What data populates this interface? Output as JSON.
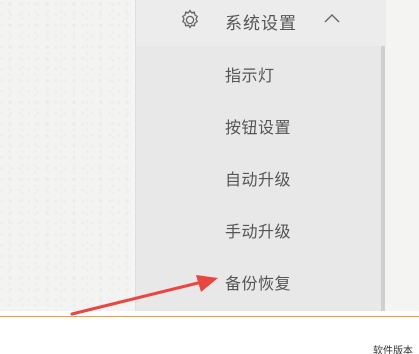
{
  "menu": {
    "header": {
      "label": "系统设置",
      "icon": "gear-icon",
      "chevron_icon": "chevron-up-icon"
    },
    "items": [
      {
        "label": "指示灯"
      },
      {
        "label": "按钮设置"
      },
      {
        "label": "自动升级"
      },
      {
        "label": "手动升级"
      },
      {
        "label": "备份恢复"
      }
    ]
  },
  "footer": {
    "version_label": "软件版本"
  },
  "annotation": {
    "arrow_color": "#e8463f"
  },
  "colors": {
    "accent_line": "#f0a33c",
    "menu_bg": "#e8e8e8",
    "text": "#555555"
  }
}
